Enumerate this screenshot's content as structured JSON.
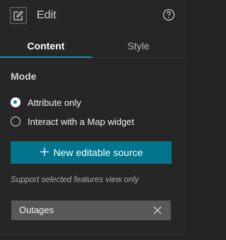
{
  "header": {
    "title": "Edit",
    "edit_icon": "edit-icon",
    "help_icon": "help-icon"
  },
  "tabs": [
    {
      "label": "Content",
      "active": true
    },
    {
      "label": "Style",
      "active": false
    }
  ],
  "mode": {
    "label": "Mode",
    "options": [
      {
        "label": "Attribute only",
        "selected": true
      },
      {
        "label": "Interact with a Map widget",
        "selected": false
      }
    ]
  },
  "actions": {
    "new_source_label": "New editable source",
    "new_source_icon": "plus-icon"
  },
  "hint": "Support selected features view only",
  "sources": [
    {
      "label": "Outages",
      "remove_icon": "close-icon"
    }
  ],
  "colors": {
    "accent": "#00a0c3",
    "button": "#00758d",
    "background": "#262626",
    "source_item": "#585858"
  }
}
